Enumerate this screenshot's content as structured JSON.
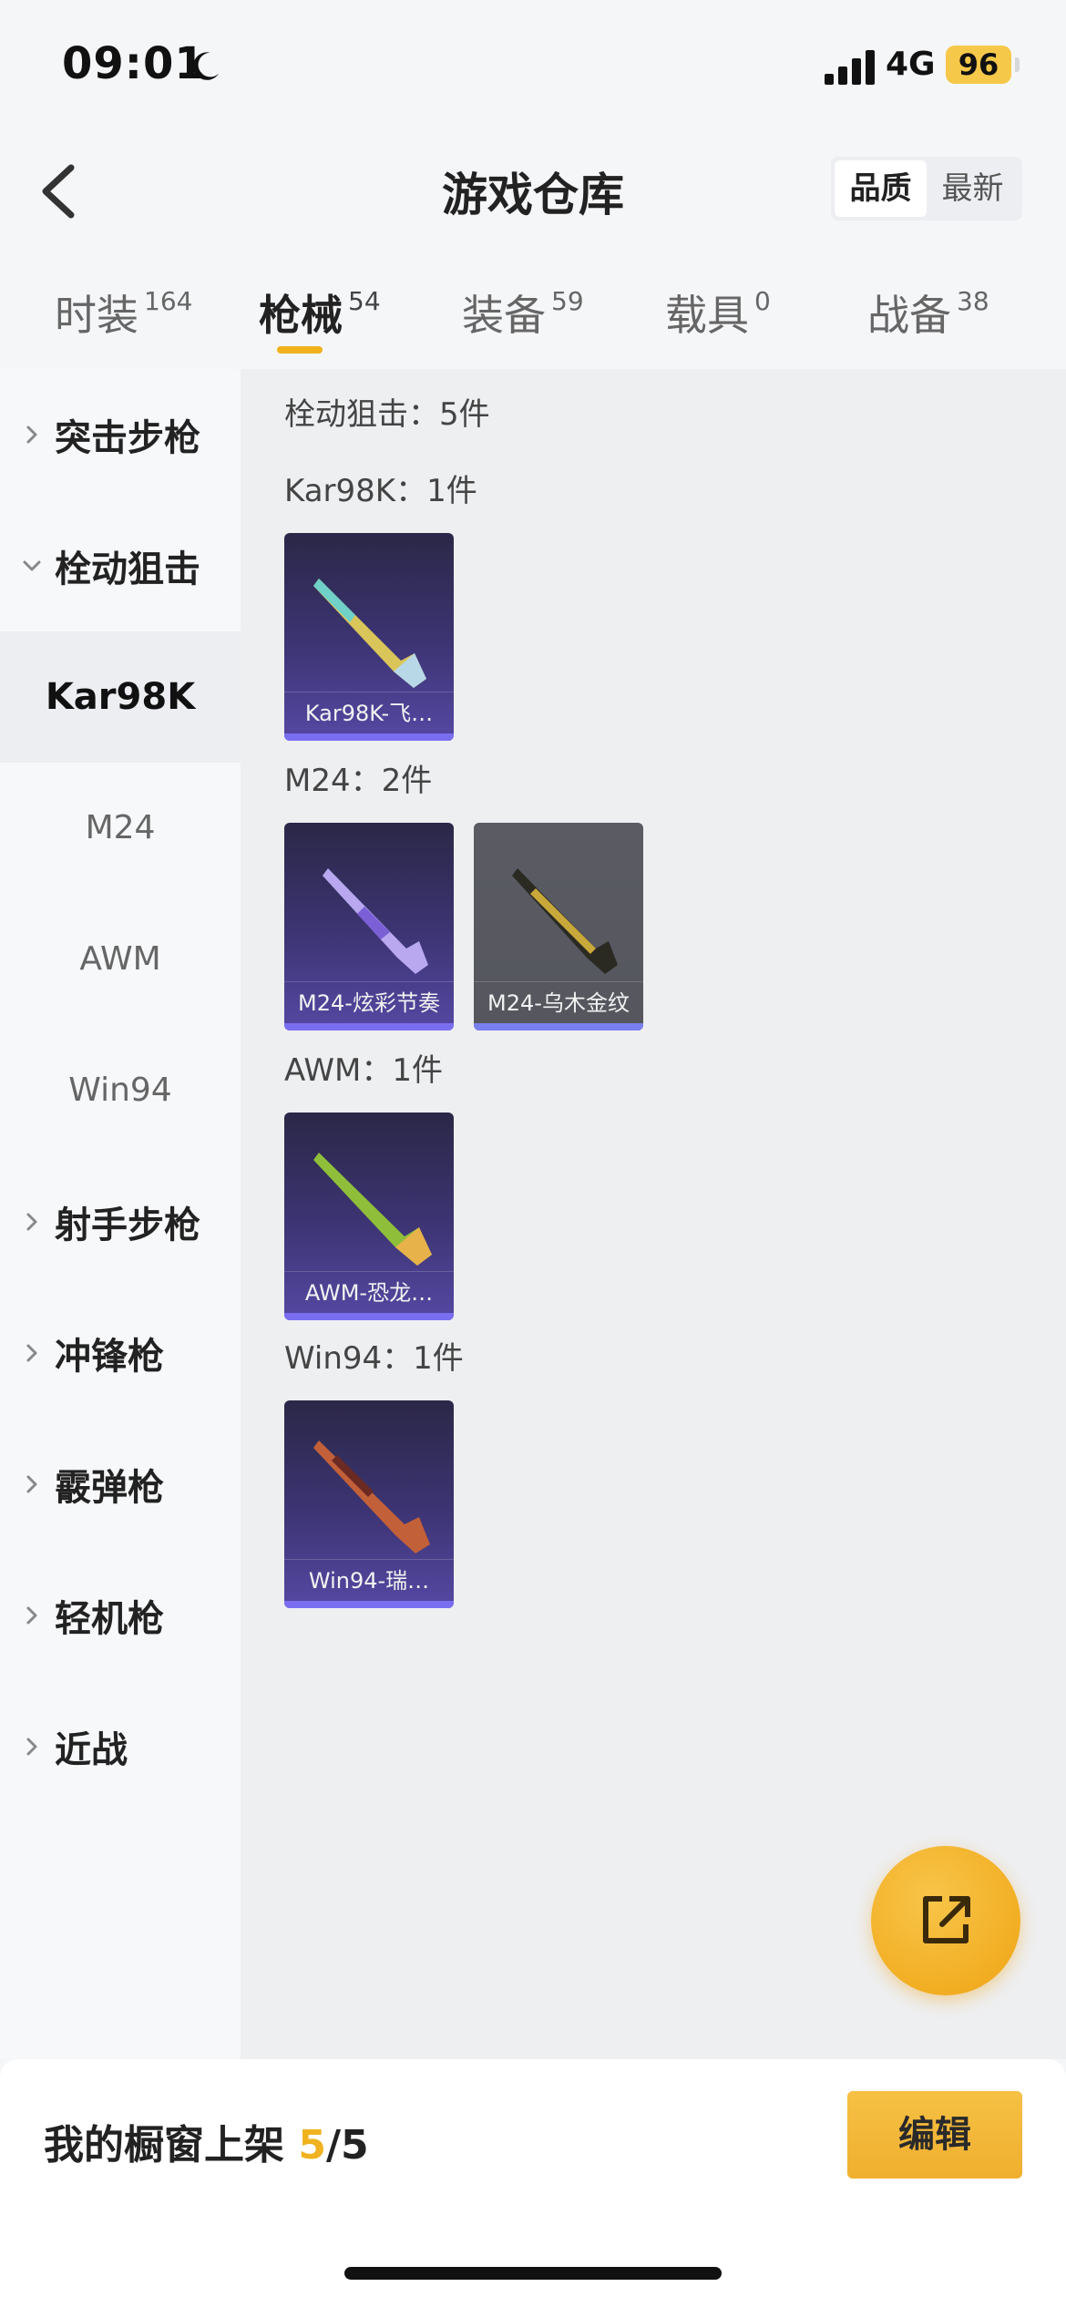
{
  "status_bar": {
    "time": "09:01",
    "network": "4G",
    "battery": "96"
  },
  "header": {
    "title": "游戏仓库",
    "sort_options": [
      "品质",
      "最新"
    ],
    "active_sort": "品质"
  },
  "tabs": [
    {
      "label": "时装",
      "count": "164"
    },
    {
      "label": "枪械",
      "count": "54"
    },
    {
      "label": "装备",
      "count": "59"
    },
    {
      "label": "载具",
      "count": "0"
    },
    {
      "label": "战备",
      "count": "38"
    }
  ],
  "sidebar": {
    "groups": [
      "突击步枪",
      "栓动狙击",
      "射手步枪",
      "冲锋枪",
      "霰弹枪",
      "轻机枪",
      "近战"
    ],
    "sub_items": [
      "Kar98K",
      "M24",
      "AWM",
      "Win94"
    ],
    "active_sub": "Kar98K"
  },
  "content": {
    "category_title": "栓动狙击：5件",
    "sections": [
      {
        "title": "Kar98K：1件",
        "items": [
          {
            "name": "Kar98K-飞…"
          }
        ]
      },
      {
        "title": "M24：2件",
        "items": [
          {
            "name": "M24-炫彩节奏"
          },
          {
            "name": "M24-乌木金纹"
          }
        ]
      },
      {
        "title": "AWM：1件",
        "items": [
          {
            "name": "AWM-恐龙…"
          }
        ]
      },
      {
        "title": "Win94：1件",
        "items": [
          {
            "name": "Win94-瑞…"
          }
        ]
      }
    ]
  },
  "bottom_bar": {
    "label": "我的橱窗上架",
    "current": "5",
    "total": "/5",
    "edit_label": "编辑"
  },
  "colors": {
    "accent": "#f0b31f",
    "card_purple": "#3d3575",
    "card_gray": "#55565e"
  },
  "icons": {
    "back": "chevron-left-icon",
    "fab": "share-external-icon",
    "moon": "moon-icon",
    "signal": "signal-icon"
  }
}
